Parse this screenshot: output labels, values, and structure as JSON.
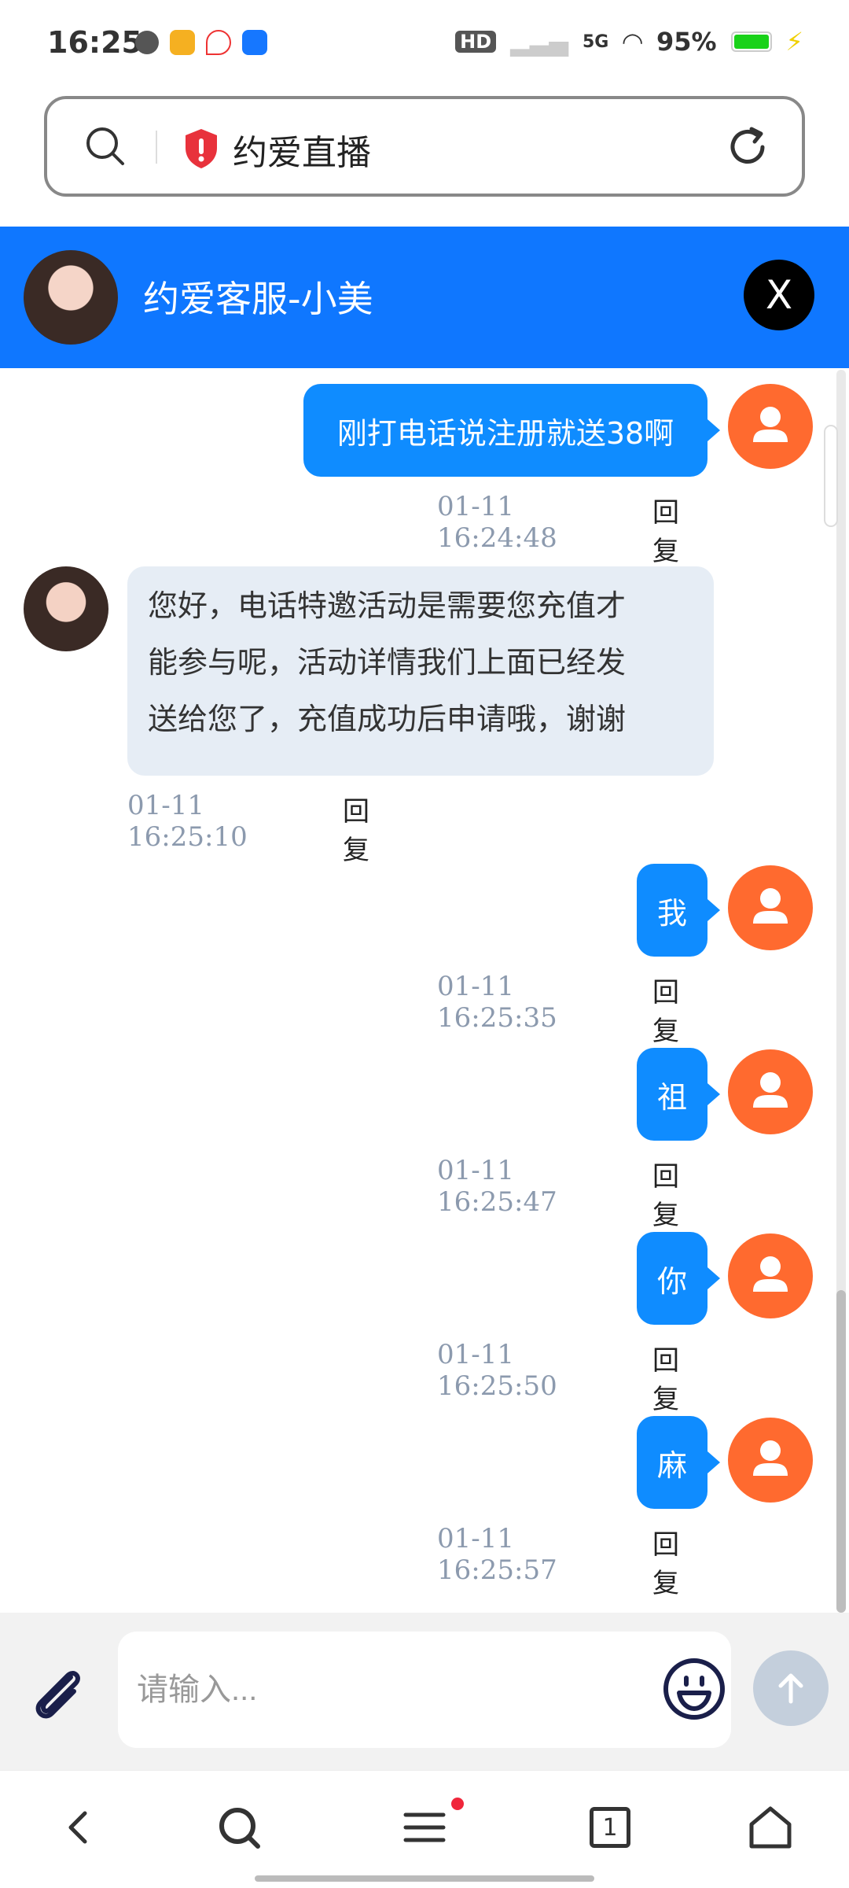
{
  "status_bar": {
    "time": "16:25",
    "battery": "95%",
    "network": "5G",
    "hd": "HD"
  },
  "address_bar": {
    "title": "约爱直播"
  },
  "chat_header": {
    "title": "约爱客服-小美",
    "close_label": "X"
  },
  "messages": [
    {
      "side": "out",
      "text": "刚打电话说注册就送38啊",
      "time": "01-11 16:24:48",
      "reply": "回复"
    },
    {
      "side": "in",
      "lines": [
        "您好，电话特邀活动是需要您充值才",
        "能参与呢，活动详情我们上面已经发",
        "送给您了，充值成功后申请哦，谢谢"
      ],
      "time": "01-11 16:25:10",
      "reply": "回复"
    },
    {
      "side": "out",
      "text": "我",
      "time": "01-11 16:25:35",
      "reply": "回复"
    },
    {
      "side": "out",
      "text": "祖",
      "time": "01-11 16:25:47",
      "reply": "回复"
    },
    {
      "side": "out",
      "text": "你",
      "time": "01-11 16:25:50",
      "reply": "回复"
    },
    {
      "side": "out",
      "text": "麻",
      "time": "01-11 16:25:57",
      "reply": "回复"
    }
  ],
  "composer": {
    "placeholder": "请输入..."
  },
  "bottom_nav": {
    "tab_count": "1"
  },
  "colors": {
    "header": "#0f77ff",
    "bubble_out": "#0f8cff",
    "bubble_in": "#e6edf5",
    "user_avatar": "#ff6a2f"
  }
}
